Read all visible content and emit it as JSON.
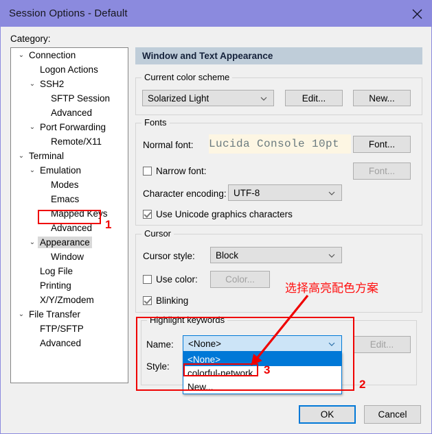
{
  "window": {
    "title": "Session Options - Default",
    "close_icon": "close-icon"
  },
  "sidebar": {
    "label": "Category:",
    "items": [
      {
        "label": "Connection",
        "indent": 0,
        "chevron": "⌄",
        "selected": false
      },
      {
        "label": "Logon Actions",
        "indent": 1,
        "chevron": "",
        "selected": false
      },
      {
        "label": "SSH2",
        "indent": 1,
        "chevron": "⌄",
        "selected": false
      },
      {
        "label": "SFTP Session",
        "indent": 2,
        "chevron": "",
        "selected": false
      },
      {
        "label": "Advanced",
        "indent": 2,
        "chevron": "",
        "selected": false
      },
      {
        "label": "Port Forwarding",
        "indent": 1,
        "chevron": "⌄",
        "selected": false
      },
      {
        "label": "Remote/X11",
        "indent": 2,
        "chevron": "",
        "selected": false
      },
      {
        "label": "Terminal",
        "indent": 0,
        "chevron": "⌄",
        "selected": false
      },
      {
        "label": "Emulation",
        "indent": 1,
        "chevron": "⌄",
        "selected": false
      },
      {
        "label": "Modes",
        "indent": 2,
        "chevron": "",
        "selected": false
      },
      {
        "label": "Emacs",
        "indent": 2,
        "chevron": "",
        "selected": false
      },
      {
        "label": "Mapped Keys",
        "indent": 2,
        "chevron": "",
        "selected": false
      },
      {
        "label": "Advanced",
        "indent": 2,
        "chevron": "",
        "selected": false
      },
      {
        "label": "Appearance",
        "indent": 1,
        "chevron": "⌄",
        "selected": true
      },
      {
        "label": "Window",
        "indent": 2,
        "chevron": "",
        "selected": false
      },
      {
        "label": "Log File",
        "indent": 1,
        "chevron": "",
        "selected": false
      },
      {
        "label": "Printing",
        "indent": 1,
        "chevron": "",
        "selected": false
      },
      {
        "label": "X/Y/Zmodem",
        "indent": 1,
        "chevron": "",
        "selected": false
      },
      {
        "label": "File Transfer",
        "indent": 0,
        "chevron": "⌄",
        "selected": false
      },
      {
        "label": "FTP/SFTP",
        "indent": 1,
        "chevron": "",
        "selected": false
      },
      {
        "label": "Advanced",
        "indent": 1,
        "chevron": "",
        "selected": false
      }
    ]
  },
  "panel": {
    "header": "Window and Text Appearance",
    "color_scheme": {
      "legend": "Current color scheme",
      "value": "Solarized Light",
      "edit_label": "Edit...",
      "new_label": "New..."
    },
    "fonts": {
      "legend": "Fonts",
      "normal_font_label": "Normal font:",
      "normal_font_value": "Lucida Console 10pt",
      "normal_font_button": "Font...",
      "narrow_font_label": "Narrow font:",
      "narrow_font_checked": false,
      "narrow_font_button": "Font...",
      "encoding_label": "Character encoding:",
      "encoding_value": "UTF-8",
      "unicode_label": "Use Unicode graphics characters",
      "unicode_checked": true
    },
    "cursor": {
      "legend": "Cursor",
      "style_label": "Cursor style:",
      "style_value": "Block",
      "use_color_label": "Use color:",
      "use_color_checked": false,
      "color_button": "Color...",
      "blinking_label": "Blinking",
      "blinking_checked": true
    },
    "highlight": {
      "legend": "Highlight keywords",
      "name_label": "Name:",
      "name_value": "<None>",
      "style_label": "Style:",
      "edit_label": "Edit...",
      "options": [
        {
          "label": "<None>",
          "selected": true
        },
        {
          "label": "colorful-network",
          "selected": false
        },
        {
          "label": "New...",
          "selected": false
        }
      ]
    }
  },
  "footer": {
    "ok_label": "OK",
    "cancel_label": "Cancel"
  },
  "annotations": {
    "accent_color": "#ef0000",
    "note_text": "选择高亮配色方案",
    "marker_1": "1",
    "marker_2": "2",
    "marker_3": "3"
  }
}
